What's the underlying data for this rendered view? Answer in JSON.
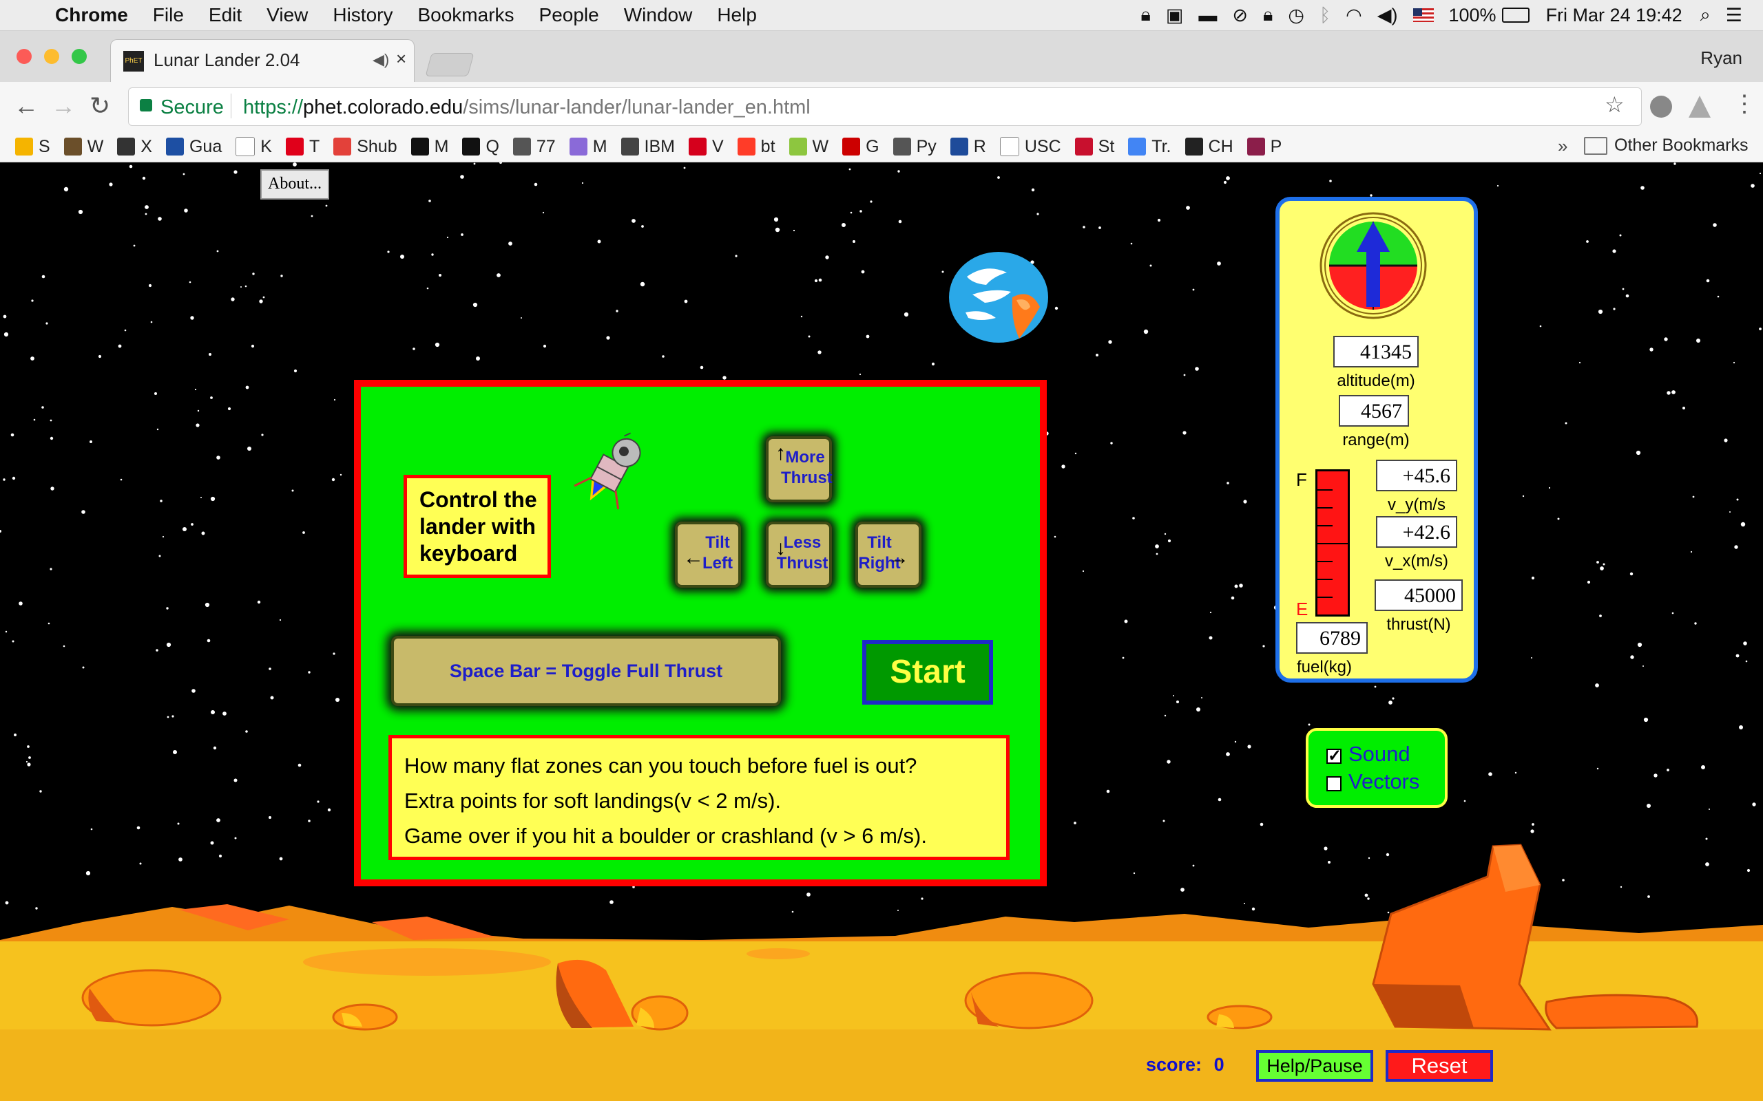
{
  "menubar": {
    "app": "Chrome",
    "items": [
      "File",
      "Edit",
      "View",
      "History",
      "Bookmarks",
      "People",
      "Window",
      "Help"
    ],
    "battery": "100%",
    "clock": "Fri Mar 24  19:42"
  },
  "tab": {
    "title": "Lunar Lander 2.04",
    "favicon_text": "PhET",
    "close": "×"
  },
  "profile": "Ryan",
  "toolbar": {
    "secure_label": "Secure",
    "url_scheme": "https://",
    "url_host": "phet.colorado.edu",
    "url_path": "/sims/lunar-lander/lunar-lander_en.html"
  },
  "bookmarks": {
    "items": [
      {
        "label": "S",
        "color": "#f5b400"
      },
      {
        "label": "W",
        "color": "#6b4f2a"
      },
      {
        "label": "X",
        "color": "#333333"
      },
      {
        "label": "Gua",
        "color": "#1d4fa3"
      },
      {
        "label": "K",
        "color": "#ffffff"
      },
      {
        "label": "T",
        "color": "#e0001a"
      },
      {
        "label": "Shub",
        "color": "#e3413a"
      },
      {
        "label": "M",
        "color": "#111111"
      },
      {
        "label": "Q",
        "color": "#111111"
      },
      {
        "label": "77",
        "color": "#555555"
      },
      {
        "label": "M",
        "color": "#8a6ad8"
      },
      {
        "label": "IBM",
        "color": "#444444"
      },
      {
        "label": "V",
        "color": "#d5001c"
      },
      {
        "label": "bt",
        "color": "#ff3c28"
      },
      {
        "label": "W",
        "color": "#8dc63f"
      },
      {
        "label": "G",
        "color": "#cc0000"
      },
      {
        "label": "Py",
        "color": "#555555"
      },
      {
        "label": "R",
        "color": "#1e4b9a"
      },
      {
        "label": "USC",
        "color": "#ffffff"
      },
      {
        "label": "St",
        "color": "#c8102e"
      },
      {
        "label": "Tr.",
        "color": "#4285f4"
      },
      {
        "label": "CH",
        "color": "#222222"
      },
      {
        "label": "P",
        "color": "#8b1e4a"
      }
    ],
    "more": "»",
    "other": "Other Bookmarks"
  },
  "game": {
    "about_label": "About...",
    "intro": {
      "control_text": "Control the lander with keyboard",
      "keys": {
        "more_thrust": "More Thrust",
        "tilt_left": "Tilt Left",
        "less_thrust": "Less Thrust",
        "tilt_right": "Tilt Right"
      },
      "spacebar_label": "Space Bar = Toggle Full Thrust",
      "start_label": "Start",
      "instructions": [
        "How many flat zones can you touch before fuel is out?",
        "Extra points for soft landings(v < 2 m/s).",
        "Game over if you hit a boulder or crashland (v > 6 m/s)."
      ]
    },
    "gauges": {
      "altitude_value": "41345",
      "altitude_label": "altitude(m)",
      "range_value": "4567",
      "range_label": "range(m)",
      "vy_value": "+45.6",
      "vy_label": "v_y(m/s",
      "vx_value": "+42.6",
      "vx_label": "v_x(m/s)",
      "thrust_value": "45000",
      "thrust_label": "thrust(N)",
      "fuel_value": "6789",
      "fuel_label": "fuel(kg)",
      "fuel_full": "F",
      "fuel_empty": "E",
      "fuel_level": 1.0
    },
    "options": {
      "sound_label": "Sound",
      "sound_checked": true,
      "vectors_label": "Vectors",
      "vectors_checked": false
    },
    "score_label": "score:",
    "score_value": "0",
    "help_label": "Help/Pause",
    "reset_label": "Reset"
  }
}
